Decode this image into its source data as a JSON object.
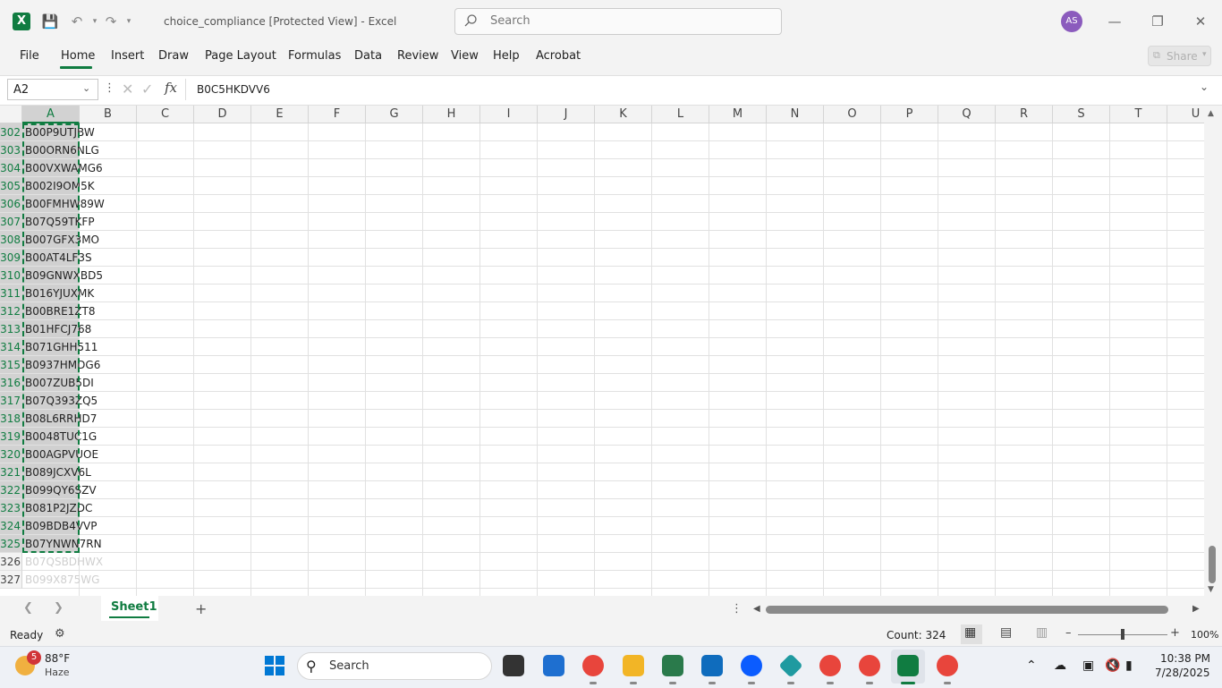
{
  "titlebar": {
    "title": "choice_compliance  [Protected View]  -  Excel",
    "search_placeholder": "Search",
    "avatar_initials": "AS"
  },
  "ribbon": {
    "tabs": [
      "File",
      "Home",
      "Insert",
      "Draw",
      "Page Layout",
      "Formulas",
      "Data",
      "Review",
      "View",
      "Help",
      "Acrobat"
    ],
    "active_tab": "Home",
    "share_label": "Share"
  },
  "formula_bar": {
    "name_box": "A2",
    "formula": "B0C5HKDVV6"
  },
  "grid": {
    "columns": [
      "A",
      "B",
      "C",
      "D",
      "E",
      "F",
      "G",
      "H",
      "I",
      "J",
      "K",
      "L",
      "M",
      "N",
      "O",
      "P",
      "Q",
      "R",
      "S",
      "T",
      "U"
    ],
    "selected_column": "A",
    "rows": [
      {
        "num": "302",
        "a": "B00P9UTJBW"
      },
      {
        "num": "303",
        "a": "B00ORN6NLG"
      },
      {
        "num": "304",
        "a": "B00VXWAMG6"
      },
      {
        "num": "305",
        "a": "B002I9OM5K"
      },
      {
        "num": "306",
        "a": "B00FMHW89W"
      },
      {
        "num": "307",
        "a": "B07Q59TKFP"
      },
      {
        "num": "308",
        "a": "B007GFX3MO"
      },
      {
        "num": "309",
        "a": "B00AT4LF3S"
      },
      {
        "num": "310",
        "a": "B09GNWXBD5"
      },
      {
        "num": "311",
        "a": "B016YJUXMK"
      },
      {
        "num": "312",
        "a": "B00BRE1ZT8"
      },
      {
        "num": "313",
        "a": "B01HFCJ768"
      },
      {
        "num": "314",
        "a": "B071GHH511"
      },
      {
        "num": "315",
        "a": "B0937HMDG6"
      },
      {
        "num": "316",
        "a": "B007ZUB5DI"
      },
      {
        "num": "317",
        "a": "B07Q393ZQ5"
      },
      {
        "num": "318",
        "a": "B08L6RRHD7"
      },
      {
        "num": "319",
        "a": "B0048TUC1G"
      },
      {
        "num": "320",
        "a": "B00AGPVUOE"
      },
      {
        "num": "321",
        "a": "B089JCXV6L"
      },
      {
        "num": "322",
        "a": "B099QY6SZV"
      },
      {
        "num": "323",
        "a": "B081P2JZDC"
      },
      {
        "num": "324",
        "a": "B09BDB4VVP"
      },
      {
        "num": "325",
        "a": "B07YNWN7RN"
      },
      {
        "num": "326",
        "a": "B07QSBDHWX"
      },
      {
        "num": "327",
        "a": "B099X875WG"
      }
    ],
    "selected_row_count": 24
  },
  "sheets": {
    "tabs": [
      "Sheet1"
    ],
    "active": "Sheet1"
  },
  "statusbar": {
    "ready": "Ready",
    "count": "Count: 324",
    "zoom": "100%"
  },
  "taskbar": {
    "weather_temp": "88°F",
    "weather_cond": "Haze",
    "weather_badge": "5",
    "search_label": "Search",
    "time": "10:38 PM",
    "date": "7/28/2025"
  },
  "colors": {
    "excel_green": "#107c41",
    "selection_fill": "#d0d0d0"
  }
}
